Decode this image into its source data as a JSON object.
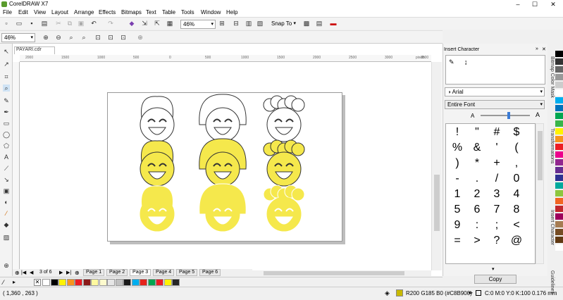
{
  "app": {
    "title": "CorelDRAW X7"
  },
  "menu": [
    "File",
    "Edit",
    "View",
    "Layout",
    "Arrange",
    "Effects",
    "Bitmaps",
    "Text",
    "Table",
    "Tools",
    "Window",
    "Help"
  ],
  "toolbar": {
    "zoom": "46%",
    "snap": "Snap To"
  },
  "propbar": {
    "zoom": "46%"
  },
  "document": {
    "tab": "PAYARI.cdr"
  },
  "ruler": {
    "h": [
      "2000",
      "1500",
      "1000",
      "500",
      "0",
      "500",
      "1000",
      "1500",
      "2000",
      "2500",
      "3000",
      "3500"
    ],
    "unit": "pixels"
  },
  "pages": {
    "counter": "3 of 6",
    "tabs": [
      "Page 1",
      "Page 2",
      "Page 3",
      "Page 4",
      "Page 5",
      "Page 6"
    ],
    "active": 2
  },
  "status": {
    "coords": "( 1,360 , 263 )",
    "fill": "R200 G185 B0 (#C8B900)",
    "outline": "C:0 M:0 Y:0 K:100  0.176 mm"
  },
  "panel": {
    "title": "Insert Character",
    "font": "Arial",
    "range": "Entire Font",
    "copy": "Copy"
  },
  "chars": [
    "!",
    "\"",
    "#",
    "$",
    "%",
    "&",
    "'",
    "(",
    ")",
    "*",
    "+",
    ",",
    "-",
    ".",
    "/",
    "0",
    "1",
    "2",
    "3",
    "4",
    "5",
    "6",
    "7",
    "8",
    "9",
    ":",
    ";",
    "<",
    "=",
    ">",
    "?",
    "@"
  ],
  "side_tabs": [
    "Bitmap Color Mask",
    "Transformations",
    "Insert Character",
    "Guidelines"
  ],
  "colors": {
    "yellow": "#f5e84c",
    "outline": "#333333"
  },
  "palette": [
    "#ffffff",
    "#000000",
    "#fff200",
    "#f7941d",
    "#ed1c24",
    "#8b1a1a",
    "#fff99f",
    "#fdfacd",
    "#e6e6e6",
    "#c0c0c0",
    "#1a1a1a",
    "#00aeef",
    "#e5231b",
    "#00a651",
    "#ed1c24",
    "#fff200",
    "#262626"
  ],
  "right_palette": [
    "#000000",
    "#333333",
    "#666666",
    "#999999",
    "#cccccc",
    "#ffffff",
    "#00aeef",
    "#0072bc",
    "#00a651",
    "#39b54a",
    "#fff200",
    "#f7941d",
    "#ed1c24",
    "#ec008c",
    "#92278f",
    "#662d91",
    "#2e3192",
    "#00a99d",
    "#8dc63f",
    "#f26522",
    "#c1272d",
    "#9e005d",
    "#a67c52",
    "#754c24",
    "#603913",
    "#ffffff"
  ]
}
